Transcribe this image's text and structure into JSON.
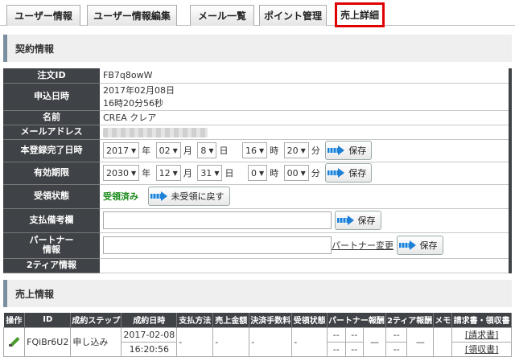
{
  "tabs": [
    {
      "label": "ユーザー情報"
    },
    {
      "label": "ユーザー情報編集"
    },
    {
      "label": "メール一覧"
    },
    {
      "label": "ポイント管理"
    },
    {
      "label": "売上詳細"
    }
  ],
  "contract": {
    "section_title": "契約情報",
    "order_id_label": "注文ID",
    "order_id": "FB7q8owW",
    "applied_label": "申込日時",
    "applied_date": "2017年02月08日",
    "applied_time": "16時20分56秒",
    "name_label": "名前",
    "name": "CREA クレア",
    "email_label": "メールアドレス",
    "email": "",
    "reg_label": "本登録完了日時",
    "reg": {
      "year": "2017",
      "month": "02",
      "day": "8",
      "hour": "16",
      "minute": "20"
    },
    "exp_label": "有効期限",
    "exp": {
      "year": "2030",
      "month": "12",
      "day": "31",
      "hour": "0",
      "minute": "00"
    },
    "units": {
      "year": "年",
      "month": "月",
      "day": "日",
      "hour": "時",
      "minute": "分"
    },
    "receipt_label": "受領状態",
    "receipt_status": "受領済み",
    "revert_button": "未受領に戻す",
    "payment_note_label": "支払備考欄",
    "partner_label_1": "パートナー",
    "partner_label_2": "情報",
    "partner_change_link": "パートナー変更",
    "tier2_label": "2ティア情報",
    "save_button": "保存"
  },
  "sales": {
    "section_title": "売上情報",
    "headers": [
      "操作",
      "ID",
      "成約ステップ",
      "成約日時",
      "支払方法",
      "売上金額",
      "決済手数料",
      "受領状態",
      "パートナー報酬",
      "2ティア報酬",
      "メモ",
      "請求書・領収書"
    ],
    "row": {
      "id": "FQiBr6U2",
      "step": "申し込み",
      "date": "2017-02-08",
      "time": "16:20:56",
      "method": "-",
      "amount": "-",
      "fee": "-",
      "status": "-",
      "partner_reward_a": "--",
      "partner_reward_b": "--",
      "partner_reward_c": "--",
      "partner_reward_d": "--",
      "partner_reward_e": "—",
      "tier2_a": "--",
      "tier2_b": "--",
      "tier2_c": "—",
      "memo": "",
      "invoice_link": "[請求書]",
      "receipt_link": "[領収書]"
    }
  }
}
